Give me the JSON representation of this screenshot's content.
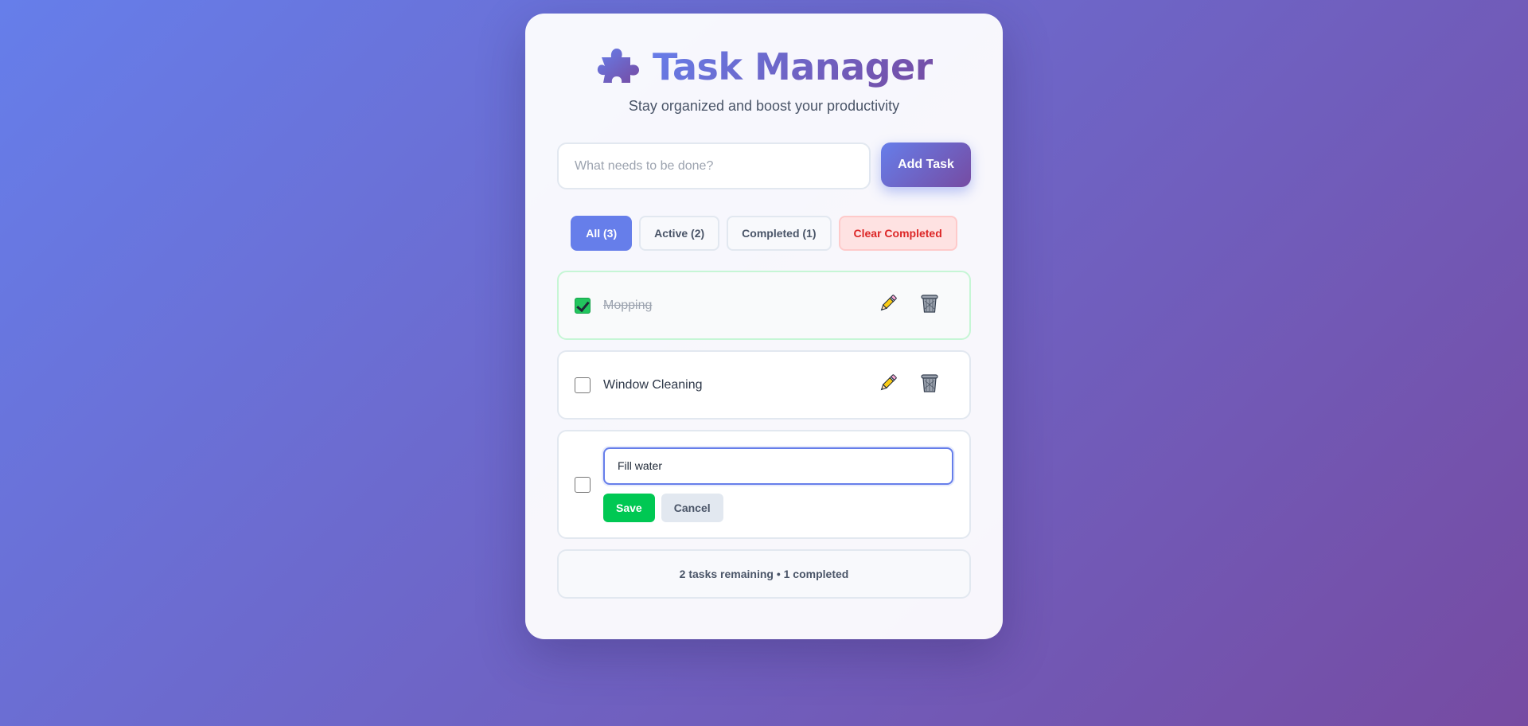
{
  "header": {
    "title": "Task Manager",
    "subtitle": "Stay organized and boost your productivity",
    "icon": "puzzle-piece-icon"
  },
  "add_task": {
    "placeholder": "What needs to be done?",
    "value": "",
    "button_label": "Add Task"
  },
  "filters": {
    "all_label": "All (3)",
    "active_label": "Active (2)",
    "completed_label": "Completed (1)",
    "clear_label": "Clear Completed",
    "selected": "All (3)"
  },
  "tasks": [
    {
      "text": "Mopping",
      "completed": true,
      "edit_icon": "pencil-icon",
      "delete_icon": "trash-icon"
    },
    {
      "text": "Window Cleaning",
      "completed": false,
      "edit_icon": "pencil-icon",
      "delete_icon": "trash-icon"
    },
    {
      "text": "Fill water",
      "completed": false,
      "editing": true,
      "save_label": "Save",
      "cancel_label": "Cancel"
    }
  ],
  "footer": {
    "summary": "2 tasks remaining • 1 completed"
  },
  "colors": {
    "accent_start": "#667eea",
    "accent_end": "#764ba2",
    "save_green": "#00c853",
    "danger_red": "#dc2626",
    "checkbox_green": "#22c55e"
  }
}
